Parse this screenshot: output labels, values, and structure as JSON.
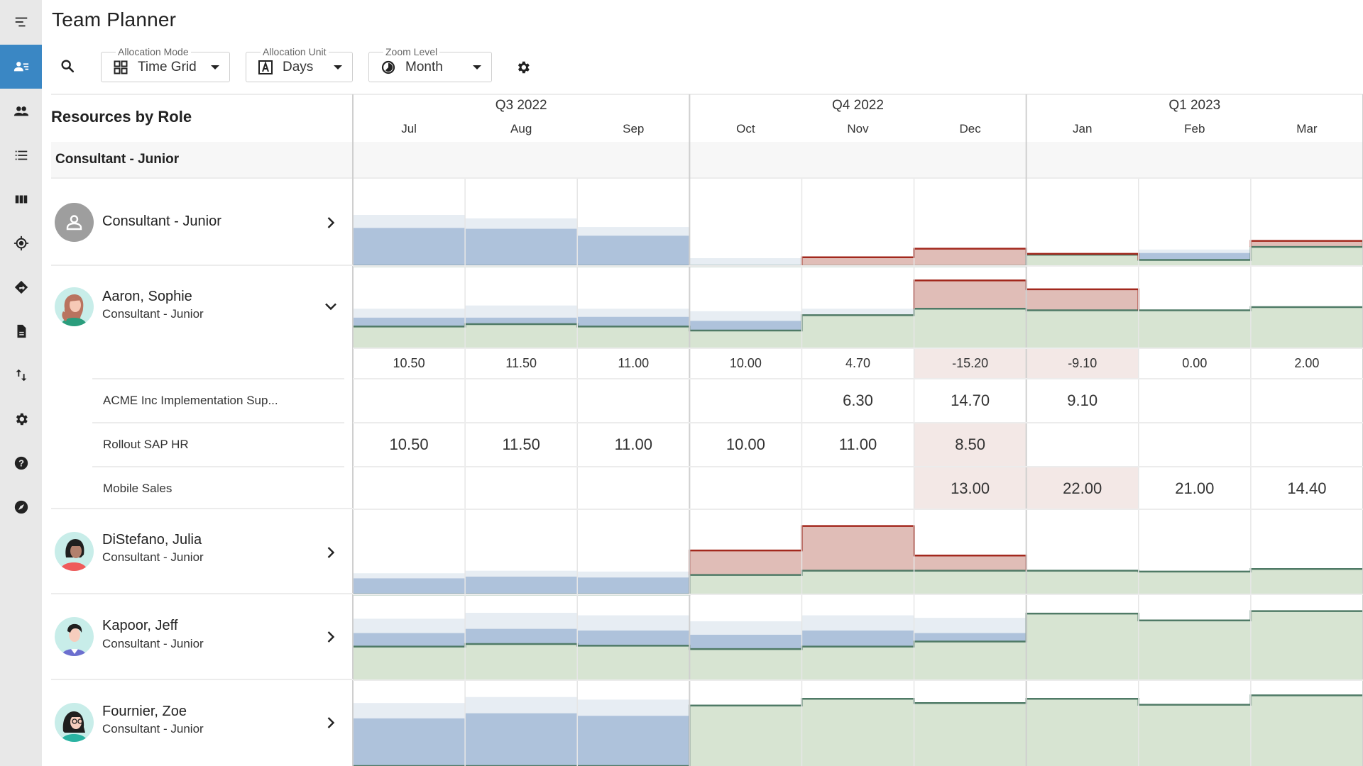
{
  "app": {
    "title": "Team Planner"
  },
  "sidebar": {
    "items": [
      {
        "icon": "menu-icon",
        "label": "Menu",
        "active": false
      },
      {
        "icon": "team-planner-icon",
        "label": "Team Planner",
        "active": true
      },
      {
        "icon": "people-icon",
        "label": "Resources",
        "active": false
      },
      {
        "icon": "list-icon",
        "label": "List",
        "active": false
      },
      {
        "icon": "columns-icon",
        "label": "Board",
        "active": false
      },
      {
        "icon": "target-icon",
        "label": "Target",
        "active": false
      },
      {
        "icon": "directions-icon",
        "label": "Directions",
        "active": false
      },
      {
        "icon": "document-icon",
        "label": "Documents",
        "active": false
      },
      {
        "icon": "sort-icon",
        "label": "Import/Export",
        "active": false
      },
      {
        "icon": "settings-icon",
        "label": "Settings",
        "active": false
      },
      {
        "icon": "help-icon",
        "label": "Help",
        "active": false
      },
      {
        "icon": "compass-icon",
        "label": "Explore",
        "active": false
      }
    ]
  },
  "toolbar": {
    "search_icon": "search-icon",
    "allocation_mode": {
      "legend": "Allocation Mode",
      "value": "Time Grid",
      "icon": "grid-icon"
    },
    "allocation_unit": {
      "legend": "Allocation Unit",
      "value": "Days",
      "icon": "letter-a-icon"
    },
    "zoom_level": {
      "legend": "Zoom Level",
      "value": "Month",
      "icon": "clock-pie-icon"
    },
    "settings_icon": "gear-icon"
  },
  "panel": {
    "heading": "Resources by Role",
    "group_label": "Consultant - Junior"
  },
  "timeline": {
    "quarters": [
      {
        "label": "Q3 2022",
        "months": 3
      },
      {
        "label": "Q4 2022",
        "months": 3
      },
      {
        "label": "Q1 2023",
        "months": 3
      }
    ],
    "months": [
      "Jul",
      "Aug",
      "Sep",
      "Oct",
      "Nov",
      "Dec",
      "Jan",
      "Feb",
      "Mar"
    ]
  },
  "colors": {
    "accent": "#3a87c4",
    "available_fill": "#d7e4d2",
    "available_line": "#4f7a66",
    "assigned_fill": "#aec2db",
    "tentative_fill": "#e7edf3",
    "over_fill": "#e0bdb7",
    "over_line": "#a2281d",
    "negative_cell": "#f3e8e6"
  },
  "resources": [
    {
      "name": "Consultant - Junior",
      "subtitle": "",
      "avatar": "generic-person",
      "expanded": false,
      "chart": {
        "available": [
          0,
          0,
          0,
          0,
          0,
          0,
          0.13,
          0.07,
          0.22
        ],
        "assigned": [
          0.44,
          0.43,
          0.35,
          0,
          0,
          0,
          0,
          0.15,
          0
        ],
        "tentative": [
          0.59,
          0.55,
          0.45,
          0.09,
          0,
          0,
          0,
          0.19,
          0
        ],
        "over": [
          0,
          0,
          0,
          0,
          0.1,
          0.2,
          0.14,
          0,
          0.29
        ]
      }
    },
    {
      "name": "Aaron, Sophie",
      "subtitle": "Consultant - Junior",
      "avatar": "woman-auburn-hair",
      "expanded": true,
      "chart": {
        "available": [
          0.26,
          0.29,
          0.26,
          0.21,
          0.4,
          0.48,
          0.46,
          0.46,
          0.5
        ],
        "assigned": [
          0.37,
          0.37,
          0.38,
          0.33,
          0,
          0,
          0,
          0,
          0
        ],
        "tentative": [
          0.48,
          0.52,
          0.48,
          0.45,
          0.48,
          0,
          0,
          0,
          0
        ],
        "over": [
          0,
          0,
          0,
          0,
          0,
          0.83,
          0.72,
          0,
          0
        ]
      },
      "totals": [
        "10.50",
        "11.50",
        "11.00",
        "10.00",
        "4.70",
        "-15.20",
        "-9.10",
        "0.00",
        "2.00"
      ],
      "totals_negative": [
        false,
        false,
        false,
        false,
        false,
        true,
        true,
        false,
        false
      ],
      "projects": [
        {
          "name": "ACME Inc Implementation Sup...",
          "values": [
            "",
            "",
            "",
            "",
            "6.30",
            "14.70",
            "9.10",
            "",
            ""
          ],
          "highlight": [
            false,
            false,
            false,
            false,
            false,
            false,
            false,
            false,
            false
          ]
        },
        {
          "name": "Rollout SAP HR",
          "values": [
            "10.50",
            "11.50",
            "11.00",
            "10.00",
            "11.00",
            "8.50",
            "",
            "",
            ""
          ],
          "highlight": [
            false,
            false,
            false,
            false,
            false,
            true,
            false,
            false,
            false
          ]
        },
        {
          "name": "Mobile Sales",
          "values": [
            "",
            "",
            "",
            "",
            "",
            "13.00",
            "22.00",
            "21.00",
            "14.40"
          ],
          "highlight": [
            false,
            false,
            false,
            false,
            false,
            true,
            true,
            false,
            false
          ]
        }
      ]
    },
    {
      "name": "DiStefano, Julia",
      "subtitle": "Consultant - Junior",
      "avatar": "woman-dark-hair",
      "expanded": false,
      "chart": {
        "available": [
          0,
          0,
          0,
          0.23,
          0.28,
          0.28,
          0.28,
          0.27,
          0.3
        ],
        "assigned": [
          0.19,
          0.21,
          0.2,
          0,
          0,
          0,
          0,
          0,
          0
        ],
        "tentative": [
          0.25,
          0.28,
          0.27,
          0,
          0,
          0,
          0,
          0,
          0
        ],
        "over": [
          0,
          0,
          0,
          0.52,
          0.81,
          0.46,
          0,
          0,
          0
        ]
      }
    },
    {
      "name": "Kapoor, Jeff",
      "subtitle": "Consultant - Junior",
      "avatar": "man-black-hair",
      "expanded": false,
      "chart": {
        "available": [
          0.39,
          0.42,
          0.4,
          0.36,
          0.39,
          0.45,
          0.78,
          0.7,
          0.81
        ],
        "assigned": [
          0.55,
          0.6,
          0.58,
          0.53,
          0.58,
          0.55,
          0,
          0,
          0
        ],
        "tentative": [
          0.72,
          0.79,
          0.76,
          0.69,
          0.76,
          0.73,
          0,
          0,
          0
        ],
        "over": [
          0,
          0,
          0,
          0,
          0,
          0,
          0,
          0,
          0
        ]
      }
    },
    {
      "name": "Fournier, Zoe",
      "subtitle": "Consultant - Junior",
      "avatar": "woman-glasses",
      "expanded": false,
      "chart": {
        "available": [
          0,
          0,
          0,
          0.71,
          0.79,
          0.74,
          0.79,
          0.72,
          0.83
        ],
        "assigned": [
          0.56,
          0.62,
          0.59,
          0,
          0,
          0,
          0,
          0,
          0
        ],
        "tentative": [
          0.74,
          0.81,
          0.78,
          0,
          0,
          0,
          0,
          0,
          0
        ],
        "over": [
          0,
          0,
          0,
          0,
          0,
          0,
          0,
          0,
          0
        ]
      }
    }
  ]
}
